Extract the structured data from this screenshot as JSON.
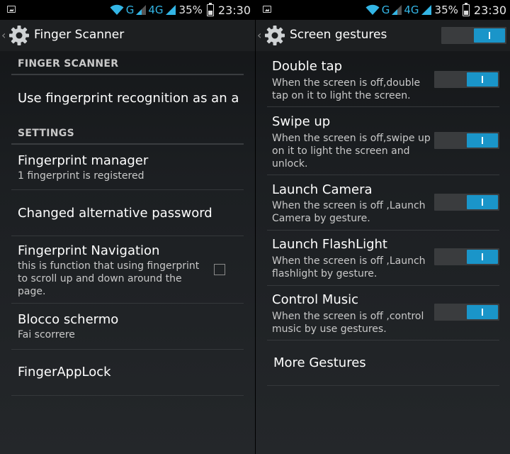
{
  "status": {
    "network": "G",
    "network2": "4G",
    "battery": "35%",
    "time": "23:30"
  },
  "left": {
    "title": "Finger Scanner",
    "sections": {
      "finger_scanner": "FINGER SCANNER",
      "settings": "SETTINGS"
    },
    "fingerprint_recognition": "Use fingerprint recognition as an a",
    "fingerprint_manager": {
      "title": "Fingerprint manager",
      "sub": "1 fingerprint is registered"
    },
    "changed_password": "Changed alternative password",
    "fingerprint_navigation": {
      "title": "Fingerprint Navigation",
      "sub_lines": [
        "this is function that using fingerprint",
        "to scroll up and down around the",
        "page."
      ],
      "checked": false
    },
    "blocco_schermo": {
      "title": "Blocco schermo",
      "sub": "Fai scorrere"
    },
    "finger_app_lock": "FingerAppLock"
  },
  "right": {
    "title": "Screen gestures",
    "master_toggle": true,
    "gestures": [
      {
        "title": "Double tap",
        "sub_lines": [
          "When the screen is off,double",
          "tap on it to light the screen."
        ],
        "on": true
      },
      {
        "title": "Swipe up",
        "sub_lines": [
          "When the screen is off,swipe up",
          "on it to light the screen and",
          "unlock."
        ],
        "on": true
      },
      {
        "title": "Launch Camera",
        "sub_lines": [
          "When the screen is off ,Launch",
          "Camera by gesture."
        ],
        "on": true
      },
      {
        "title": "Launch FlashLight",
        "sub_lines": [
          "When the screen is off ,Launch",
          "flashlight by gesture."
        ],
        "on": true
      },
      {
        "title": "Control Music",
        "sub_lines": [
          "When the screen is off ,control",
          "music by use gestures."
        ],
        "on": true
      }
    ],
    "more_gestures": "More Gestures"
  },
  "colors": {
    "accent": "#1a95c9",
    "status_blue": "#33b5e5"
  },
  "icons": {
    "wifi": "wifi-icon",
    "signal": "signal-icon",
    "battery": "battery-icon",
    "settings": "gear-icon",
    "back": "chevron-left-icon",
    "notification": "image-notification-icon"
  }
}
